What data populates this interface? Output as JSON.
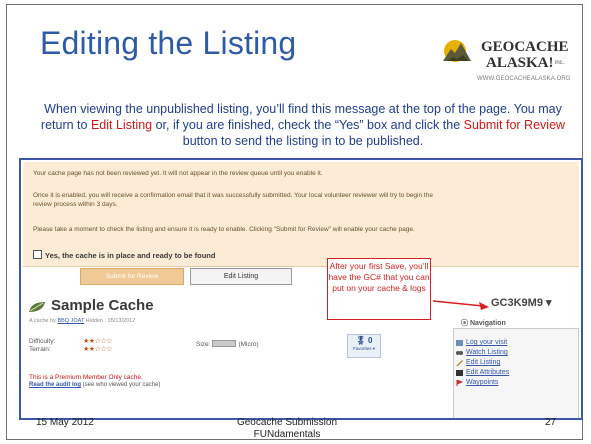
{
  "slide": {
    "title": "Editing the Listing",
    "intro_a": "When viewing the unpublished listing, you’ll find this message at the top of the page.  You may return to ",
    "intro_edit": "Edit Listing",
    "intro_b": " or, if you are finished, check the “Yes” box and click the ",
    "intro_submit": "Submit for Review",
    "intro_c": " button to send the listing in to be published.",
    "footer_date": "15 May 2012",
    "footer_center_1": "Geocache Submission",
    "footer_center_2": "FUNdamentals",
    "footer_page": "27"
  },
  "logo": {
    "line1": "GEOCACHE",
    "line2": "ALASKA!",
    "tm": "inc.",
    "url": "WWW.GEOCACHEALASKA.ORG",
    "color_mountain": "#5a5a3a",
    "color_sun": "#e6b000"
  },
  "listing": {
    "notice_1": "Your cache page has not been reviewed yet. It will not appear in the review queue until you enable it.",
    "notice_2": "Once it is enabled, you will receive a confirmation email that it was successfully submitted. Your local volunteer reviewer will try to begin the",
    "notice_2b": "review process within 3 days.",
    "notice_3": "Please take a moment to check the listing and ensure it is ready to enable. Clicking \"Submit for Review\" will enable your cache page.",
    "checkbox_label": "Yes, the cache is in place and ready to be found",
    "submit_button": "Submit for Review",
    "edit_button": "Edit Listing",
    "callout": "After your first Save, you’ll have the GC# that you can put on your cache & logs",
    "gc_code": "GC3K9M9 ▾",
    "cache_name": "Sample Cache",
    "byline_a": "A cache by ",
    "byline_owner": "BBQ JOAT",
    "byline_b": "   Hidden : 05/13/2012",
    "difficulty_label": "Difficulty:",
    "terrain_label": "Terrain:",
    "difficulty_stars": "★★☆☆☆",
    "terrain_stars": "★★☆☆☆",
    "size_label": "Size:",
    "size_value": "(Micro)",
    "favorites_count": "0",
    "favorites_label": "Favorites ▾",
    "premium_text": "This is a Premium Member Only cache.",
    "audit_link": "Read the audit log",
    "audit_rest": " (see who viewed your cache)",
    "nav_title": "Navigation",
    "nav_items": [
      "Log your visit",
      "Watch Listing",
      "Edit Listing",
      "Edit Attributes",
      "Waypoints"
    ],
    "accent_red": "#d42020",
    "accent_blue": "#2e5aa8"
  }
}
